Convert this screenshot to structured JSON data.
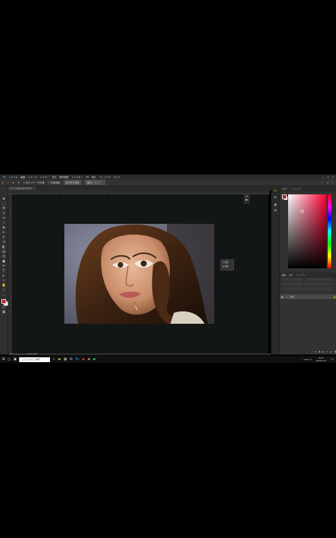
{
  "menubar": {
    "items": [
      "ファイル",
      "編集",
      "イメージ",
      "レイヤー",
      "書式",
      "選択範囲",
      "フィルター",
      "3D",
      "表示",
      "ウィンドウ",
      "ヘルプ"
    ]
  },
  "options": {
    "sample_label": "全レイヤーを対象",
    "enhance_label": "自動強調",
    "select_subject_label": "被写体を選択",
    "select_mask_label": "選択とマスク..."
  },
  "document": {
    "tab_title": "ファイル名.jpg @ 50%"
  },
  "statusbar": {
    "text": "50%  ドキュメント : 4.69M/4.69M"
  },
  "floating_panel": {
    "item1": "属性",
    "item2": "調整"
  },
  "panels": {
    "color_tab": "カラー",
    "swatches_tab": "スウォッチ",
    "props_tabs": [
      "属性",
      "調整",
      "ライブラリ"
    ],
    "layer_name": "背景"
  },
  "taskbar": {
    "search_placeholder": "ここに入力して検索",
    "time": "16:47",
    "date": "2019/01/15"
  },
  "colors": {
    "fg": "#c0273a",
    "bg": "#ffffff",
    "picker_hue": "#ff0033",
    "canvas": "#121615"
  }
}
